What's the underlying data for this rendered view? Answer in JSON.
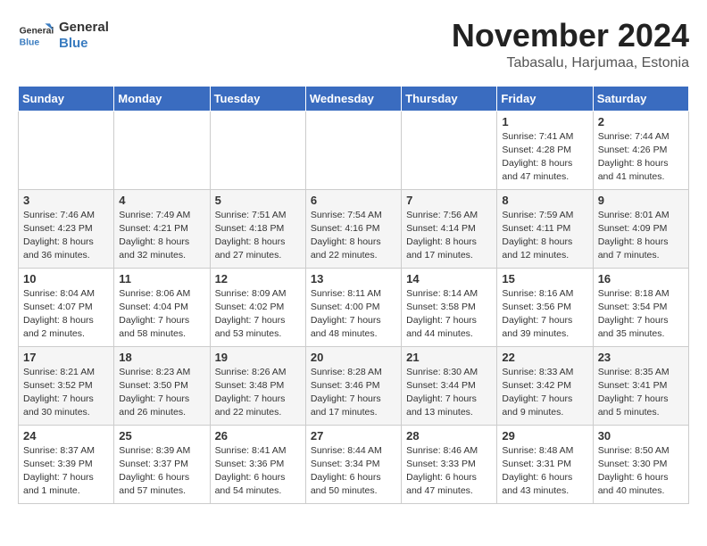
{
  "header": {
    "logo_line1": "General",
    "logo_line2": "Blue",
    "month_year": "November 2024",
    "location": "Tabasalu, Harjumaa, Estonia"
  },
  "days_of_week": [
    "Sunday",
    "Monday",
    "Tuesday",
    "Wednesday",
    "Thursday",
    "Friday",
    "Saturday"
  ],
  "weeks": [
    [
      {
        "day": "",
        "info": ""
      },
      {
        "day": "",
        "info": ""
      },
      {
        "day": "",
        "info": ""
      },
      {
        "day": "",
        "info": ""
      },
      {
        "day": "",
        "info": ""
      },
      {
        "day": "1",
        "info": "Sunrise: 7:41 AM\nSunset: 4:28 PM\nDaylight: 8 hours and 47 minutes."
      },
      {
        "day": "2",
        "info": "Sunrise: 7:44 AM\nSunset: 4:26 PM\nDaylight: 8 hours and 41 minutes."
      }
    ],
    [
      {
        "day": "3",
        "info": "Sunrise: 7:46 AM\nSunset: 4:23 PM\nDaylight: 8 hours and 36 minutes."
      },
      {
        "day": "4",
        "info": "Sunrise: 7:49 AM\nSunset: 4:21 PM\nDaylight: 8 hours and 32 minutes."
      },
      {
        "day": "5",
        "info": "Sunrise: 7:51 AM\nSunset: 4:18 PM\nDaylight: 8 hours and 27 minutes."
      },
      {
        "day": "6",
        "info": "Sunrise: 7:54 AM\nSunset: 4:16 PM\nDaylight: 8 hours and 22 minutes."
      },
      {
        "day": "7",
        "info": "Sunrise: 7:56 AM\nSunset: 4:14 PM\nDaylight: 8 hours and 17 minutes."
      },
      {
        "day": "8",
        "info": "Sunrise: 7:59 AM\nSunset: 4:11 PM\nDaylight: 8 hours and 12 minutes."
      },
      {
        "day": "9",
        "info": "Sunrise: 8:01 AM\nSunset: 4:09 PM\nDaylight: 8 hours and 7 minutes."
      }
    ],
    [
      {
        "day": "10",
        "info": "Sunrise: 8:04 AM\nSunset: 4:07 PM\nDaylight: 8 hours and 2 minutes."
      },
      {
        "day": "11",
        "info": "Sunrise: 8:06 AM\nSunset: 4:04 PM\nDaylight: 7 hours and 58 minutes."
      },
      {
        "day": "12",
        "info": "Sunrise: 8:09 AM\nSunset: 4:02 PM\nDaylight: 7 hours and 53 minutes."
      },
      {
        "day": "13",
        "info": "Sunrise: 8:11 AM\nSunset: 4:00 PM\nDaylight: 7 hours and 48 minutes."
      },
      {
        "day": "14",
        "info": "Sunrise: 8:14 AM\nSunset: 3:58 PM\nDaylight: 7 hours and 44 minutes."
      },
      {
        "day": "15",
        "info": "Sunrise: 8:16 AM\nSunset: 3:56 PM\nDaylight: 7 hours and 39 minutes."
      },
      {
        "day": "16",
        "info": "Sunrise: 8:18 AM\nSunset: 3:54 PM\nDaylight: 7 hours and 35 minutes."
      }
    ],
    [
      {
        "day": "17",
        "info": "Sunrise: 8:21 AM\nSunset: 3:52 PM\nDaylight: 7 hours and 30 minutes."
      },
      {
        "day": "18",
        "info": "Sunrise: 8:23 AM\nSunset: 3:50 PM\nDaylight: 7 hours and 26 minutes."
      },
      {
        "day": "19",
        "info": "Sunrise: 8:26 AM\nSunset: 3:48 PM\nDaylight: 7 hours and 22 minutes."
      },
      {
        "day": "20",
        "info": "Sunrise: 8:28 AM\nSunset: 3:46 PM\nDaylight: 7 hours and 17 minutes."
      },
      {
        "day": "21",
        "info": "Sunrise: 8:30 AM\nSunset: 3:44 PM\nDaylight: 7 hours and 13 minutes."
      },
      {
        "day": "22",
        "info": "Sunrise: 8:33 AM\nSunset: 3:42 PM\nDaylight: 7 hours and 9 minutes."
      },
      {
        "day": "23",
        "info": "Sunrise: 8:35 AM\nSunset: 3:41 PM\nDaylight: 7 hours and 5 minutes."
      }
    ],
    [
      {
        "day": "24",
        "info": "Sunrise: 8:37 AM\nSunset: 3:39 PM\nDaylight: 7 hours and 1 minute."
      },
      {
        "day": "25",
        "info": "Sunrise: 8:39 AM\nSunset: 3:37 PM\nDaylight: 6 hours and 57 minutes."
      },
      {
        "day": "26",
        "info": "Sunrise: 8:41 AM\nSunset: 3:36 PM\nDaylight: 6 hours and 54 minutes."
      },
      {
        "day": "27",
        "info": "Sunrise: 8:44 AM\nSunset: 3:34 PM\nDaylight: 6 hours and 50 minutes."
      },
      {
        "day": "28",
        "info": "Sunrise: 8:46 AM\nSunset: 3:33 PM\nDaylight: 6 hours and 47 minutes."
      },
      {
        "day": "29",
        "info": "Sunrise: 8:48 AM\nSunset: 3:31 PM\nDaylight: 6 hours and 43 minutes."
      },
      {
        "day": "30",
        "info": "Sunrise: 8:50 AM\nSunset: 3:30 PM\nDaylight: 6 hours and 40 minutes."
      }
    ]
  ]
}
